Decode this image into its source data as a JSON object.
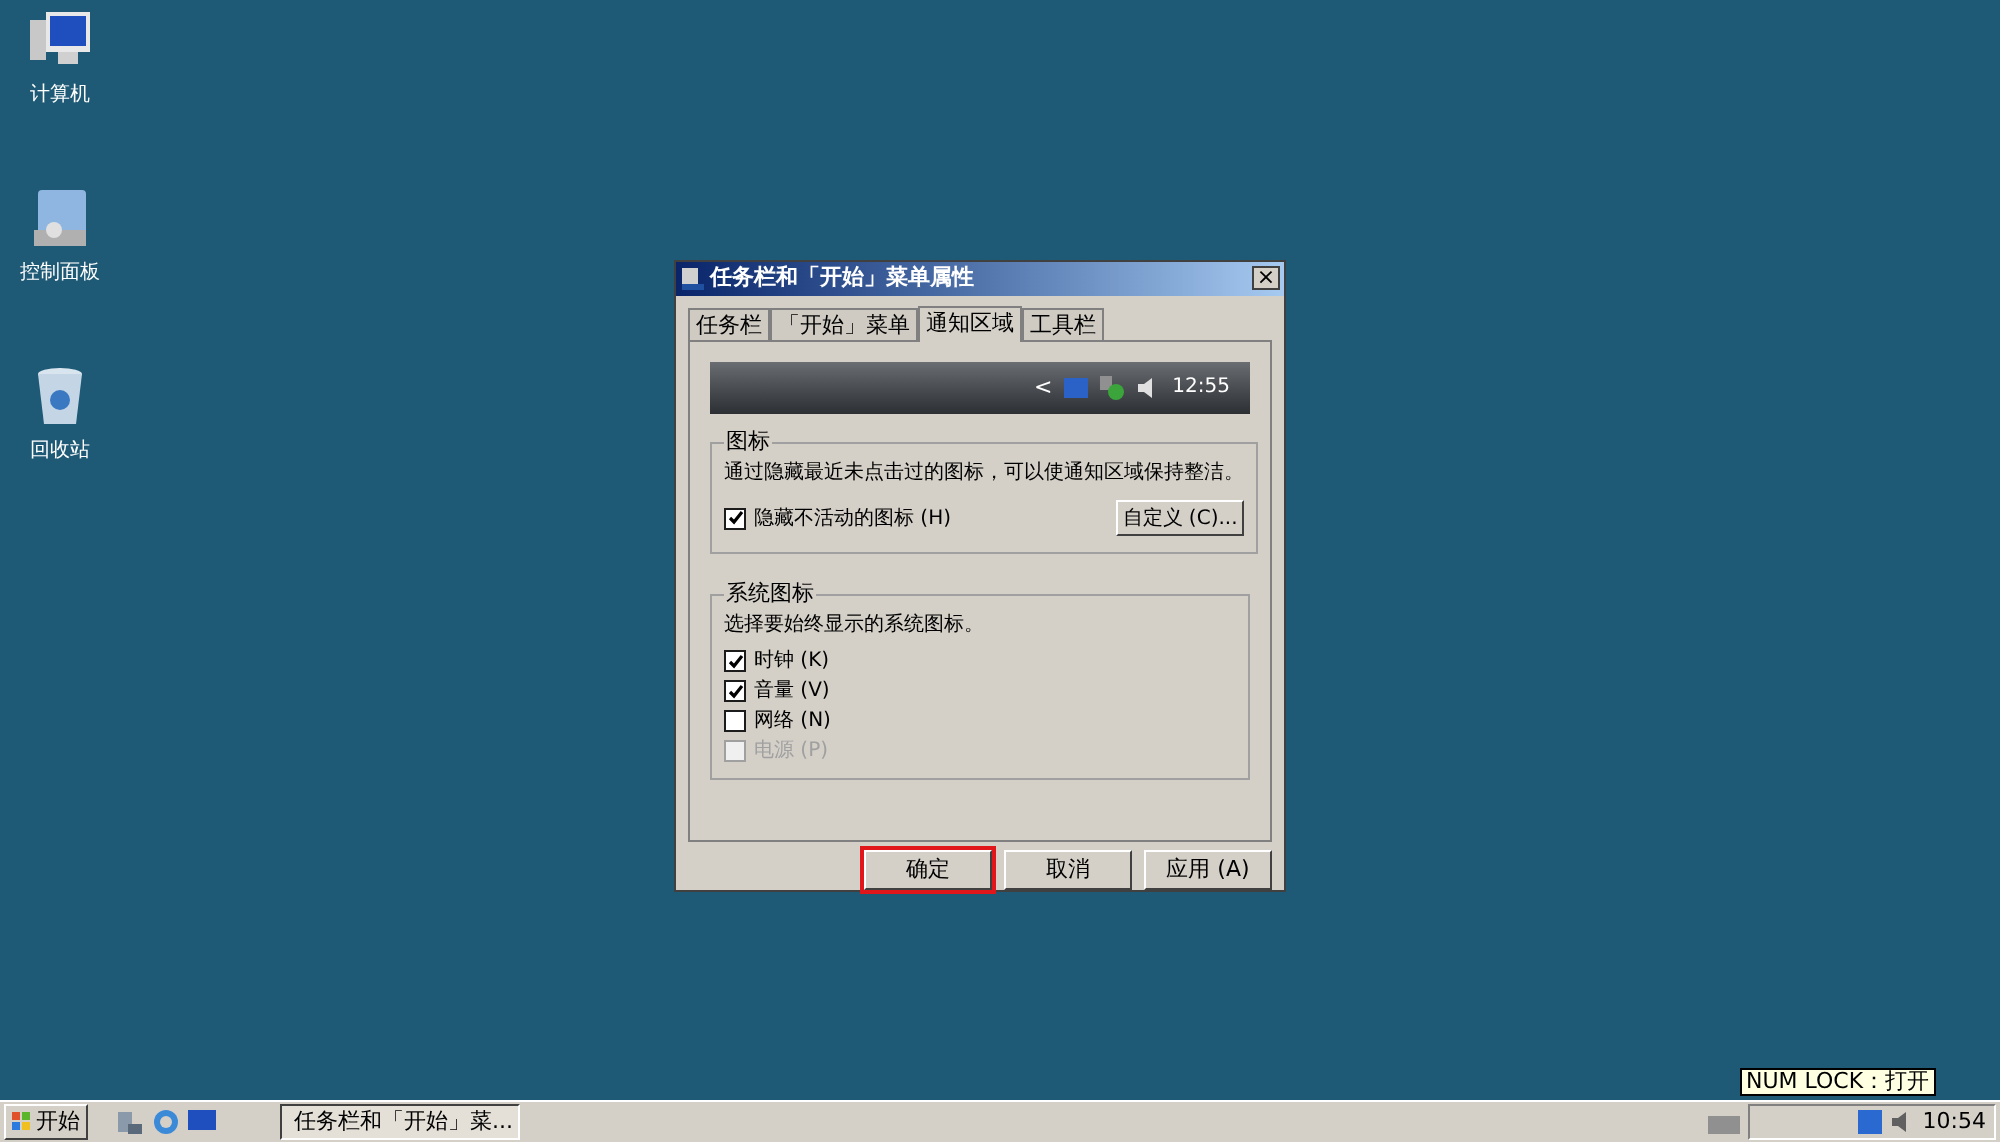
{
  "desktop_icons": [
    {
      "label": "计算机",
      "kind": "computer"
    },
    {
      "label": "控制面板",
      "kind": "panel"
    },
    {
      "label": "回收站",
      "kind": "bin"
    }
  ],
  "dialog": {
    "title": "任务栏和「开始」菜单属性",
    "close": "×",
    "tabs": [
      {
        "label": "任务栏",
        "selected": false
      },
      {
        "label": "「开始」菜单",
        "selected": false
      },
      {
        "label": "通知区域",
        "selected": true
      },
      {
        "label": "工具栏",
        "selected": false
      }
    ],
    "preview": {
      "arrow": "<",
      "time": "12:55"
    },
    "icons_group": {
      "title": "图标",
      "description": "通过隐藏最近未点击过的图标，可以使通知区域保持整洁。",
      "checkbox": {
        "label": "隐藏不活动的图标 (H)",
        "checked": true
      },
      "button": "自定义 (C)..."
    },
    "system_icons_group": {
      "title": "系统图标",
      "description": "选择要始终显示的系统图标。",
      "items": [
        {
          "label": "时钟 (K)",
          "checked": true,
          "disabled": false
        },
        {
          "label": "音量 (V)",
          "checked": true,
          "disabled": false
        },
        {
          "label": "网络 (N)",
          "checked": false,
          "disabled": false
        },
        {
          "label": "电源 (P)",
          "checked": false,
          "disabled": true
        }
      ]
    },
    "buttons": [
      {
        "label": "确定",
        "highlighted": true
      },
      {
        "label": "取消",
        "highlighted": false
      },
      {
        "label": "应用 (A)",
        "highlighted": false
      }
    ]
  },
  "taskbar": {
    "start": "开始",
    "window_button": "任务栏和「开始」菜...",
    "tooltip": "NUM LOCK：打开",
    "clock": "10:54"
  }
}
